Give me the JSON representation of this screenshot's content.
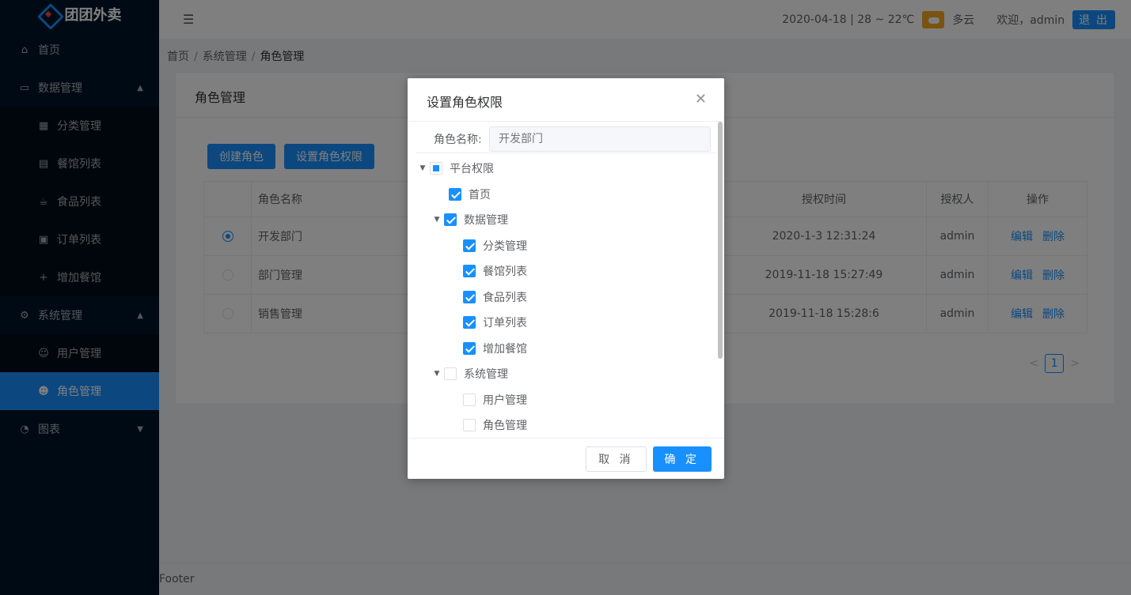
{
  "app": {
    "logo_text": "团团外卖"
  },
  "sidebar": {
    "items": [
      {
        "label": "首页",
        "icon": "home-icon"
      },
      {
        "label": "数据管理",
        "icon": "laptop-icon",
        "arrow": "⌃"
      },
      {
        "label": "分类管理",
        "icon": "grid-icon"
      },
      {
        "label": "餐馆列表",
        "icon": "store-icon"
      },
      {
        "label": "食品列表",
        "icon": "cup-icon"
      },
      {
        "label": "订单列表",
        "icon": "calendar-icon"
      },
      {
        "label": "增加餐馆",
        "icon": "plus-icon"
      },
      {
        "label": "系统管理",
        "icon": "gear-icon",
        "arrow": "⌃"
      },
      {
        "label": "用户管理",
        "icon": "user-icon"
      },
      {
        "label": "角色管理",
        "icon": "users-icon"
      },
      {
        "label": "图表",
        "icon": "pie-icon",
        "arrow": "⌄"
      }
    ]
  },
  "header": {
    "weather_text": "2020-04-18 | 28 ~ 22℃",
    "weather_desc": "多云",
    "welcome": "欢迎，admin",
    "logout_label": "退 出"
  },
  "breadcrumb": {
    "items": [
      "首页",
      "系统管理",
      "角色管理"
    ]
  },
  "card": {
    "title": "角色管理",
    "create_button": "创建角色",
    "set_perm_button": "设置角色权限",
    "columns": [
      "角色名称",
      "授权时间",
      "授权人",
      "操作"
    ],
    "rows": [
      {
        "name": "开发部门",
        "time": "2020-1-3 12:31:24",
        "user": "admin",
        "selected": true
      },
      {
        "name": "部门管理",
        "time": "2019-11-18 15:27:49",
        "user": "admin",
        "selected": false
      },
      {
        "name": "销售管理",
        "time": "2019-11-18 15:28:6",
        "user": "admin",
        "selected": false
      }
    ],
    "edit_label": "编辑",
    "delete_label": "删除",
    "pager": {
      "prev": "<",
      "current": "1",
      "next": ">"
    }
  },
  "footer": {
    "text": "Footer"
  },
  "dialog": {
    "title": "设置角色权限",
    "field_label": "角色名称:",
    "field_placeholder": "开发部门",
    "tree": [
      {
        "label": "平台权限",
        "level": 0,
        "state": "indeterminate",
        "expand": true
      },
      {
        "label": "首页",
        "level": 1,
        "state": "checked",
        "expand": false
      },
      {
        "label": "数据管理",
        "level": 1,
        "state": "checked",
        "expand": true
      },
      {
        "label": "分类管理",
        "level": 2,
        "state": "checked",
        "expand": false
      },
      {
        "label": "餐馆列表",
        "level": 2,
        "state": "checked",
        "expand": false
      },
      {
        "label": "食品列表",
        "level": 2,
        "state": "checked",
        "expand": false
      },
      {
        "label": "订单列表",
        "level": 2,
        "state": "checked",
        "expand": false
      },
      {
        "label": "增加餐馆",
        "level": 2,
        "state": "checked",
        "expand": false
      },
      {
        "label": "系统管理",
        "level": 1,
        "state": "unchecked",
        "expand": true
      },
      {
        "label": "用户管理",
        "level": 2,
        "state": "unchecked",
        "expand": false
      },
      {
        "label": "角色管理",
        "level": 2,
        "state": "unchecked",
        "expand": false
      }
    ],
    "cancel_label": "取 消",
    "confirm_label": "确 定"
  },
  "colors": {
    "primary": "#1890ff",
    "sidebar_bg": "#001529",
    "active_bg": "#1890ff"
  }
}
